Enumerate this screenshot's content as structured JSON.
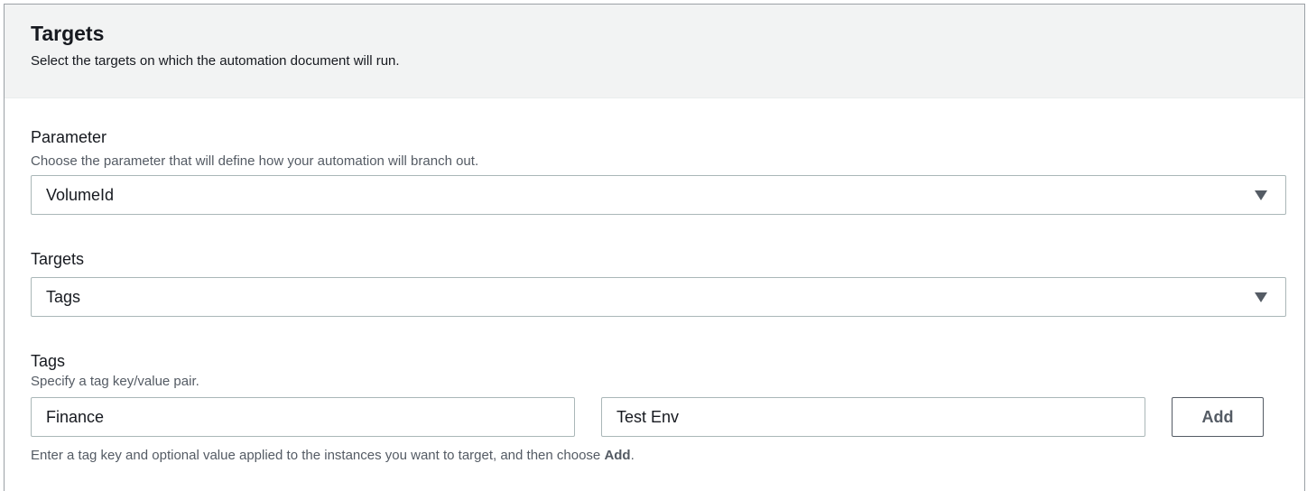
{
  "header": {
    "title": "Targets",
    "description": "Select the targets on which the automation document will run."
  },
  "parameter": {
    "label": "Parameter",
    "description": "Choose the parameter that will define how your automation will branch out.",
    "selected": "VolumeId",
    "caret_icon": "caret-down-icon"
  },
  "targets": {
    "label": "Targets",
    "selected": "Tags",
    "caret_icon": "caret-down-icon"
  },
  "tags": {
    "label": "Tags",
    "description": "Specify a tag key/value pair.",
    "key_value": "Finance",
    "value_value": "Test Env",
    "add_label": "Add",
    "hint_prefix": "Enter a tag key and optional value applied to the instances you want to target, and then choose ",
    "hint_bold": "Add",
    "hint_suffix": "."
  }
}
